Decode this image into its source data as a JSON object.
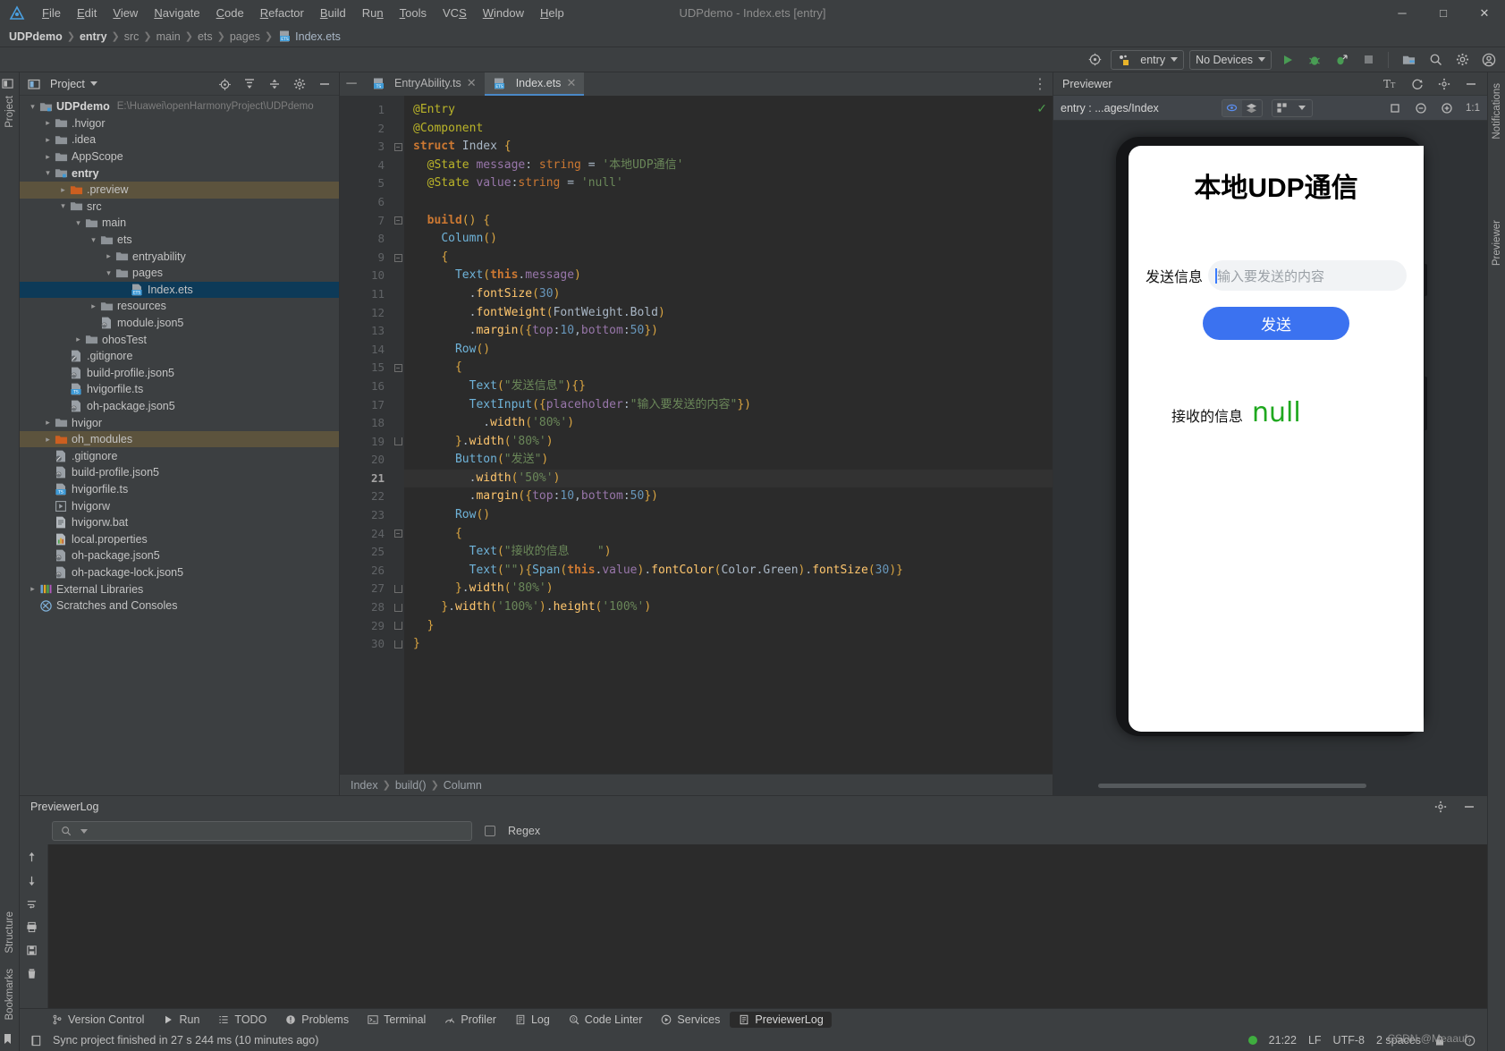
{
  "window": {
    "title": "UDPdemo - Index.ets [entry]",
    "controls": [
      "minimize",
      "maximize",
      "close"
    ]
  },
  "menubar": {
    "items": [
      "File",
      "Edit",
      "View",
      "Navigate",
      "Code",
      "Refactor",
      "Build",
      "Run",
      "Tools",
      "VCS",
      "Window",
      "Help"
    ]
  },
  "breadcrumb_nav": {
    "items": [
      "UDPdemo",
      "entry",
      "src",
      "main",
      "ets",
      "pages",
      "Index.ets"
    ]
  },
  "toolbar": {
    "target_icon": "target-icon",
    "module_label": "entry",
    "device_label": "No Devices",
    "run_label": "run-icon",
    "debug_label": "debug-icon",
    "profile_label": "profile-icon",
    "stop_label": "stop-icon",
    "device_manager_label": "device-manager-icon",
    "project_structure_label": "project-structure-icon",
    "search_label": "search-icon",
    "settings_label": "gear-icon",
    "account_label": "account-icon"
  },
  "project_panel": {
    "title": "Project",
    "tree": [
      {
        "indent": 0,
        "arrow": "down",
        "icon": "module-folder",
        "label": "UDPdemo",
        "bold": true,
        "path": "E:\\Huawei\\openHarmonyProject\\UDPdemo",
        "state": "normal"
      },
      {
        "indent": 1,
        "arrow": "right",
        "icon": "folder",
        "label": ".hvigor",
        "state": "normal"
      },
      {
        "indent": 1,
        "arrow": "right",
        "icon": "folder",
        "label": ".idea",
        "state": "normal"
      },
      {
        "indent": 1,
        "arrow": "right",
        "icon": "folder",
        "label": "AppScope",
        "state": "normal"
      },
      {
        "indent": 1,
        "arrow": "down",
        "icon": "module-folder",
        "label": "entry",
        "bold": true,
        "state": "normal"
      },
      {
        "indent": 2,
        "arrow": "right",
        "icon": "folder-orange",
        "label": ".preview",
        "state": "context"
      },
      {
        "indent": 2,
        "arrow": "down",
        "icon": "folder",
        "label": "src",
        "state": "normal"
      },
      {
        "indent": 3,
        "arrow": "down",
        "icon": "folder",
        "label": "main",
        "state": "normal"
      },
      {
        "indent": 4,
        "arrow": "down",
        "icon": "folder",
        "label": "ets",
        "state": "normal"
      },
      {
        "indent": 5,
        "arrow": "right",
        "icon": "folder",
        "label": "entryability",
        "state": "normal"
      },
      {
        "indent": 5,
        "arrow": "down",
        "icon": "folder",
        "label": "pages",
        "state": "normal"
      },
      {
        "indent": 6,
        "arrow": "none",
        "icon": "ets-file",
        "label": "Index.ets",
        "state": "selected"
      },
      {
        "indent": 4,
        "arrow": "right",
        "icon": "folder",
        "label": "resources",
        "state": "normal"
      },
      {
        "indent": 4,
        "arrow": "none",
        "icon": "json-file",
        "label": "module.json5",
        "state": "normal"
      },
      {
        "indent": 3,
        "arrow": "right",
        "icon": "folder",
        "label": "ohosTest",
        "state": "normal"
      },
      {
        "indent": 2,
        "arrow": "none",
        "icon": "gitignore-file",
        "label": ".gitignore",
        "state": "normal"
      },
      {
        "indent": 2,
        "arrow": "none",
        "icon": "json-file",
        "label": "build-profile.json5",
        "state": "normal"
      },
      {
        "indent": 2,
        "arrow": "none",
        "icon": "ts-file",
        "label": "hvigorfile.ts",
        "state": "normal"
      },
      {
        "indent": 2,
        "arrow": "none",
        "icon": "json-file",
        "label": "oh-package.json5",
        "state": "normal"
      },
      {
        "indent": 1,
        "arrow": "right",
        "icon": "folder",
        "label": "hvigor",
        "state": "normal"
      },
      {
        "indent": 1,
        "arrow": "right",
        "icon": "folder-orange",
        "label": "oh_modules",
        "state": "context"
      },
      {
        "indent": 1,
        "arrow": "none",
        "icon": "gitignore-file",
        "label": ".gitignore",
        "state": "normal"
      },
      {
        "indent": 1,
        "arrow": "none",
        "icon": "json-file",
        "label": "build-profile.json5",
        "state": "normal"
      },
      {
        "indent": 1,
        "arrow": "none",
        "icon": "ts-file",
        "label": "hvigorfile.ts",
        "state": "normal"
      },
      {
        "indent": 1,
        "arrow": "none",
        "icon": "script-file",
        "label": "hvigorw",
        "state": "normal"
      },
      {
        "indent": 1,
        "arrow": "none",
        "icon": "bat-file",
        "label": "hvigorw.bat",
        "state": "normal"
      },
      {
        "indent": 1,
        "arrow": "none",
        "icon": "properties-file",
        "label": "local.properties",
        "state": "normal"
      },
      {
        "indent": 1,
        "arrow": "none",
        "icon": "json-file",
        "label": "oh-package.json5",
        "state": "normal"
      },
      {
        "indent": 1,
        "arrow": "none",
        "icon": "json-file",
        "label": "oh-package-lock.json5",
        "state": "normal"
      },
      {
        "indent": 0,
        "arrow": "right",
        "icon": "library",
        "label": "External Libraries",
        "state": "normal"
      },
      {
        "indent": 0,
        "arrow": "none",
        "icon": "scratches",
        "label": "Scratches and Consoles",
        "state": "normal"
      }
    ]
  },
  "editor": {
    "tabs": [
      {
        "label": "EntryAbility.ts",
        "icon": "ts-file",
        "active": false
      },
      {
        "label": "Index.ets",
        "icon": "ets-file",
        "active": true
      }
    ],
    "current_line": 21,
    "inspection_status": "ok-check",
    "lines": [
      {
        "n": 1,
        "text": "@Entry",
        "fold": "none"
      },
      {
        "n": 2,
        "text": "@Component",
        "fold": "none"
      },
      {
        "n": 3,
        "text": "struct Index {",
        "fold": "minus"
      },
      {
        "n": 4,
        "text": "  @State message: string = '本地UDP通信'",
        "fold": "none"
      },
      {
        "n": 5,
        "text": "  @State value:string = 'null'",
        "fold": "none"
      },
      {
        "n": 6,
        "text": "",
        "fold": "none"
      },
      {
        "n": 7,
        "text": "  build() {",
        "fold": "minus"
      },
      {
        "n": 8,
        "text": "    Column()",
        "fold": "none"
      },
      {
        "n": 9,
        "text": "    {",
        "fold": "minus"
      },
      {
        "n": 10,
        "text": "      Text(this.message)",
        "fold": "none"
      },
      {
        "n": 11,
        "text": "        .fontSize(30)",
        "fold": "none"
      },
      {
        "n": 12,
        "text": "        .fontWeight(FontWeight.Bold)",
        "fold": "none"
      },
      {
        "n": 13,
        "text": "        .margin({top:10,bottom:50})",
        "fold": "none"
      },
      {
        "n": 14,
        "text": "      Row()",
        "fold": "none"
      },
      {
        "n": 15,
        "text": "      {",
        "fold": "minus"
      },
      {
        "n": 16,
        "text": "        Text(\"发送信息\"){}",
        "fold": "none"
      },
      {
        "n": 17,
        "text": "        TextInput({placeholder:\"输入要发送的内容\"})",
        "fold": "none"
      },
      {
        "n": 18,
        "text": "          .width('80%')",
        "fold": "none"
      },
      {
        "n": 19,
        "text": "      }.width('80%')",
        "fold": "end"
      },
      {
        "n": 20,
        "text": "      Button(\"发送\")",
        "fold": "none"
      },
      {
        "n": 21,
        "text": "        .width('50%')",
        "fold": "none"
      },
      {
        "n": 22,
        "text": "        .margin({top:10,bottom:50})",
        "fold": "none"
      },
      {
        "n": 23,
        "text": "      Row()",
        "fold": "none"
      },
      {
        "n": 24,
        "text": "      {",
        "fold": "minus"
      },
      {
        "n": 25,
        "text": "        Text(\"接收的信息    \")",
        "fold": "none"
      },
      {
        "n": 26,
        "text": "        Text(\"\"){Span(this.value).fontColor(Color.Green).fontSize(30)}",
        "fold": "none"
      },
      {
        "n": 27,
        "text": "      }.width('80%')",
        "fold": "end"
      },
      {
        "n": 28,
        "text": "    }.width('100%').height('100%')",
        "fold": "end"
      },
      {
        "n": 29,
        "text": "  }",
        "fold": "end"
      },
      {
        "n": 30,
        "text": "}",
        "fold": "end"
      }
    ],
    "breadcrumbs": [
      "Index",
      "build()",
      "Column"
    ]
  },
  "previewer": {
    "title": "Previewer",
    "device_path": "entry : ...ages/Index",
    "header_icons": [
      "font-size-icon",
      "refresh-icon",
      "settings-icon",
      "minimize-icon"
    ],
    "toolbar_icons": [
      "inspector-icon",
      "layers-icon",
      "multi-device-icon",
      "chevron-down-icon",
      "rotate-icon",
      "zoom-out-icon",
      "zoom-in-icon"
    ],
    "zoom_level": "1:1",
    "app": {
      "title": "本地UDP通信",
      "send_label": "发送信息",
      "input_placeholder": "输入要发送的内容",
      "send_button": "发送",
      "receive_label": "接收的信息",
      "receive_value": "null",
      "accent_color": "#3b72f0",
      "value_color": "#1fa81f"
    }
  },
  "bottom_panel": {
    "title": "PreviewerLog",
    "search_placeholder": "",
    "regex_label": "Regex",
    "log_lines": []
  },
  "tool_strip": {
    "items": [
      {
        "label": "Version Control",
        "icon": "branch-icon",
        "active": false
      },
      {
        "label": "Run",
        "icon": "run-icon",
        "active": false
      },
      {
        "label": "TODO",
        "icon": "todo-icon",
        "active": false
      },
      {
        "label": "Problems",
        "icon": "problems-icon",
        "active": false
      },
      {
        "label": "Terminal",
        "icon": "terminal-icon",
        "active": false
      },
      {
        "label": "Profiler",
        "icon": "profiler-icon",
        "active": false
      },
      {
        "label": "Log",
        "icon": "log-icon",
        "active": false
      },
      {
        "label": "Code Linter",
        "icon": "linter-icon",
        "active": false
      },
      {
        "label": "Services",
        "icon": "services-icon",
        "active": false
      },
      {
        "label": "PreviewerLog",
        "icon": "previewerlog-icon",
        "active": true
      }
    ]
  },
  "left_rail": {
    "top_label": "Project",
    "bottom_labels": [
      "Structure",
      "Bookmarks"
    ]
  },
  "right_rail": {
    "labels": [
      "Notifications",
      "Previewer"
    ]
  },
  "status_bar": {
    "message": "Sync project finished in 27 s 244 ms (10 minutes ago)",
    "time": "21:22",
    "line_separator": "LF",
    "encoding": "UTF-8",
    "indent": "2 spaces",
    "watermark": "CSDN @Meaauf"
  }
}
